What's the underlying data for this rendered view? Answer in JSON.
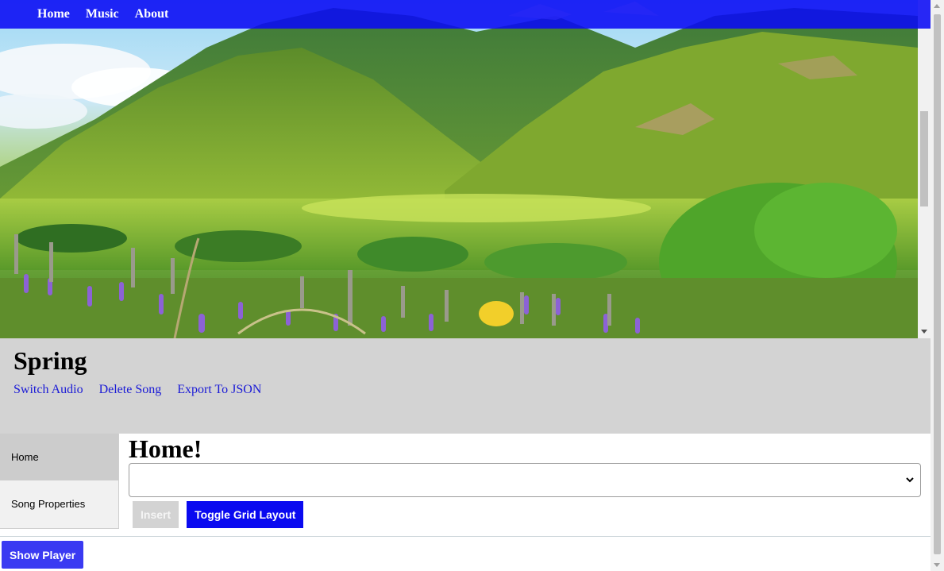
{
  "nav": {
    "items": [
      {
        "label": "Home"
      },
      {
        "label": "Music"
      },
      {
        "label": "About"
      }
    ]
  },
  "hero": {
    "image": "mountain-valley-meadow-with-purple-lupine-flowers"
  },
  "song": {
    "title": "Spring",
    "actions": [
      {
        "label": "Switch Audio"
      },
      {
        "label": "Delete Song"
      },
      {
        "label": "Export To JSON"
      }
    ]
  },
  "tabs": [
    {
      "label": "Home",
      "active": true
    },
    {
      "label": "Song Properties",
      "active": false
    }
  ],
  "main": {
    "title": "Home!",
    "select_value": "",
    "insert_label": "Insert",
    "toggle_grid_label": "Toggle Grid Layout"
  },
  "footer": {
    "show_player_label": "Show Player"
  },
  "colors": {
    "nav_bg": "#0a0af5",
    "link": "#1a1ad6",
    "primary_button": "#0a0af0",
    "show_player": "#3a3af2",
    "header_bg": "#d3d3d3"
  }
}
